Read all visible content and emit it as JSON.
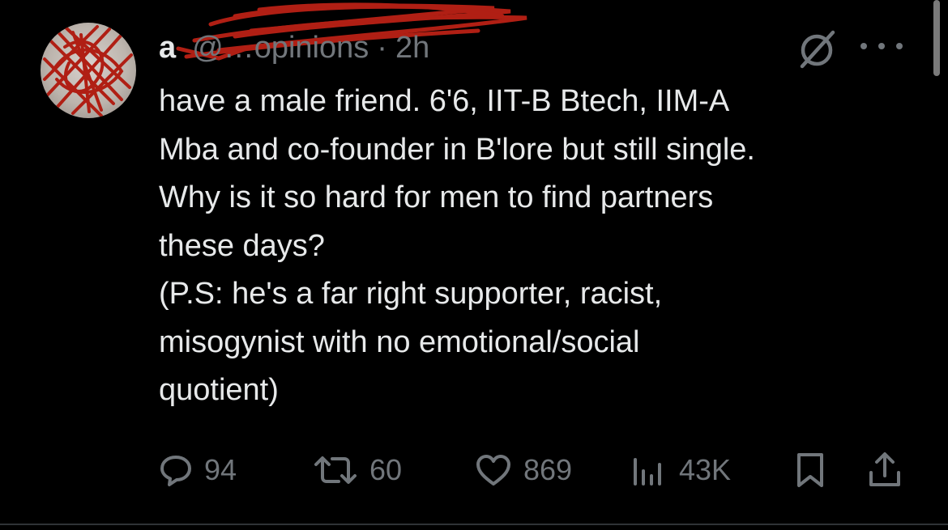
{
  "post": {
    "author_initial": "a",
    "handle_partial": "@…opinions",
    "separator": "·",
    "time": "2h",
    "text_lines": [
      "have a male friend. 6'6, IIT-B Btech, IIM-A",
      "Mba and co-founder in B'lore but still single.",
      "Why is it so hard for men to find partners",
      "these days?",
      "(P.S: he's a far right supporter, racist,",
      "misogynist with no emotional/social",
      "quotient)"
    ]
  },
  "actions": {
    "replies": "94",
    "reposts": "60",
    "likes": "869",
    "views": "43K"
  },
  "icons": {
    "avatar": "avatar-scribbled",
    "grok": "grok-icon",
    "more": "more-icon",
    "reply": "reply-icon",
    "repost": "repost-icon",
    "like": "heart-icon",
    "views": "views-bars-icon",
    "bookmark": "bookmark-icon",
    "share": "share-icon"
  },
  "colors": {
    "background": "#000000",
    "text_primary": "#e7e9ea",
    "text_secondary": "#71767b",
    "redaction": "#b01f14"
  }
}
